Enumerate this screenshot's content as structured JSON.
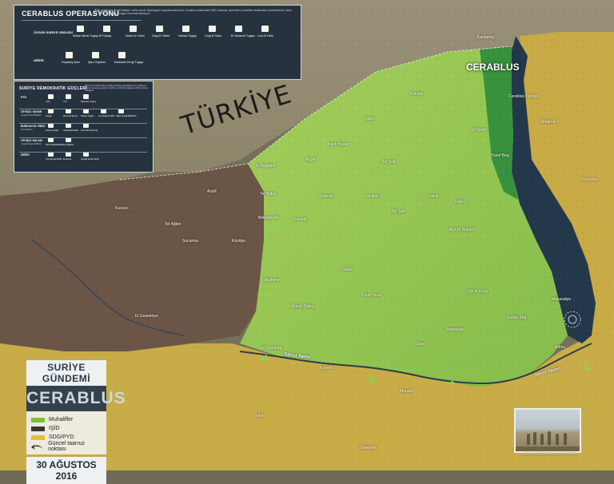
{
  "map": {
    "country_label": "TÜRKİYE",
    "city_label": "CERABLUS",
    "river_labels": [
      "Sacur Nehri",
      "Sacur Nehri"
    ],
    "place_labels": [
      "Karkamış",
      "Keklice",
      "Cerablus Tahtani",
      "Dabis",
      "Amarne",
      "El Şeyh",
      "Yusuf Beg",
      "Kanlı Hasar",
      "Ağyal",
      "Tel Şair",
      "El Bağdadi",
      "Kuhaylah",
      "Tel Bataş",
      "Dobran",
      "Kerikeli",
      "Yesinli",
      "Dabiq",
      "Ayn El Beyda",
      "Masoudiye",
      "Urum Sura",
      "Cub el Kusu",
      "Vernolgan",
      "El Guvebriye",
      "Kuzuco",
      "Tel Ağber",
      "Sucurma",
      "Azizli",
      "Kürdiye",
      "Hadie",
      "Mulhime",
      "El Gendara",
      "Kurak Deley",
      "Kuşerli",
      "Maruba",
      "Dudd",
      "Sultan Beğ",
      "Arima",
      "Bekir",
      "Zembekli",
      "Bebegesze",
      "Sekenli",
      "Tel Sair"
    ],
    "colors": {
      "rebels": "#7dbf3e",
      "isis": "#2d2a27",
      "sdf": "#d9b64a",
      "sdf_water": "#1f3344",
      "accent_green": "#2e8c3b"
    }
  },
  "panel1": {
    "title": "CERABLUS OPERASYONU",
    "description": "TSK, harekata 'Fırat Kalkanı' adını verdi. Operasyon kapsamında Azez-Cerablus hattındaki IŞİD unsurları şehirden muhalifler tarafından temizlenerek, ilave bir PYD ilerleyişine engel olunmak isteniyor.",
    "group1_label": "ÖZGÜR SURİYE ORDUSU",
    "group1_items": [
      "Sultan Murat Tugayı",
      "El Feylaq",
      "Sukur el Cebel",
      "Ceyş El Tahrir",
      "Hamza Tugayı",
      "Ceyş El Nasr",
      "El Mutasım Tugayı",
      "Liva El Fatih"
    ],
    "group1_icons": [
      "shield-icon",
      "flag-icon",
      "emblem-icon",
      "star-icon",
      "crest-icon",
      "wing-icon",
      "badge-icon",
      "torch-icon"
    ],
    "group2_label": "DİĞER",
    "group2_items": [
      "Feylakuş Şam",
      "Şam Cephesi",
      "Nureddin Zengi Tugayı"
    ],
    "group2_icons": [
      "emblem-icon",
      "shield-icon",
      "flag-icon"
    ]
  },
  "panel2": {
    "title": "SURİYE DEMOKRATİK GÜÇLERİ",
    "description": "PYD'nin öncülük ettiği ve ABD tarafından desteklenen bu koalisyon, Fırat'ın batısına geçerek Cerablus ve Münbiç bölgesine hâkim olmayı hedefliyor.",
    "rows": [
      {
        "label": "PYD",
        "sub": "",
        "items": [
          "YPG",
          "YPJ",
          "Nepenler Asayiş"
        ]
      },
      {
        "label": "CEYŞÜL SUVAR",
        "sub": "Ceyşül Suvar Birlikleri",
        "items": [
          "Asayiş",
          "Şems El Şemal",
          "Selçuk Tugayı",
          "Liva Selçuk Saffe",
          "Şahin Suvari Bölükleri"
        ]
      },
      {
        "label": "BURKAN EL FIRAT",
        "sub": "Fırat Volkanı",
        "items": [
          "Kuzey Güneşi",
          "Cabhat El Akrad",
          "Liva Tehrir El Fırat"
        ]
      },
      {
        "label": "CEYŞÜL SALAM",
        "sub": "Ceyşül Salam Birlikleri",
        "items": [
          "Sicul Kaafil Birlikleri",
          "Liva Şaheb"
        ]
      },
      {
        "label": "DİĞER",
        "sub": "",
        "items": [
          "Liva Şemal Saldiz",
          "El Ansari",
          "Ceyşül Suvar Ahrarı"
        ]
      }
    ]
  },
  "legend": {
    "header_top": "SURİYE GÜNDEMİ",
    "header_main": "CERABLUS",
    "items": [
      {
        "label": "Muhalifler",
        "color": "#7dbf3e"
      },
      {
        "label": "IŞİD",
        "color": "#3a3733"
      },
      {
        "label": "SDG/PYD",
        "color": "#e3bf3f"
      }
    ],
    "arrow_label": "Güncel taarruz noktası",
    "date": "30 AĞUSTOS 2016"
  },
  "photo": {
    "caption": "Cerablus kırsalında Türk tankları ve ÖSO askerleri"
  }
}
